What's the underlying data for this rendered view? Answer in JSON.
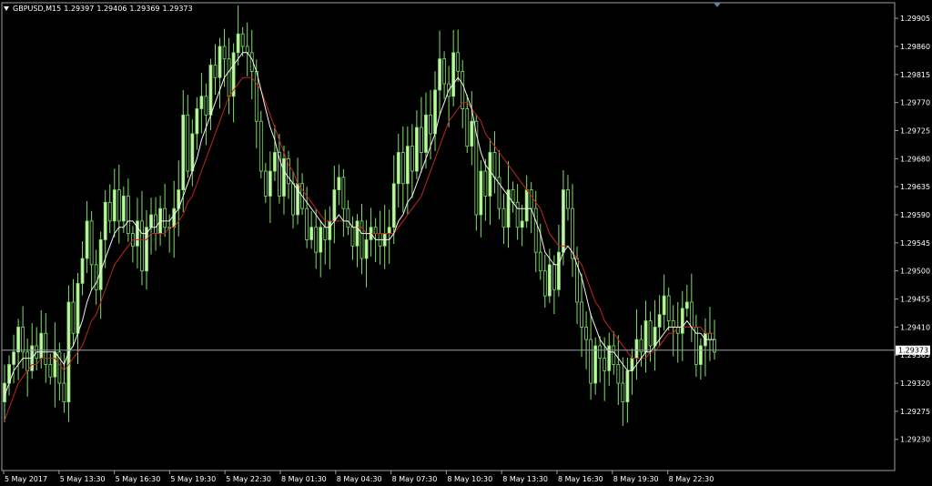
{
  "header": {
    "symbol": "GBPUSD,M15",
    "open": "1.29397",
    "high": "1.29406",
    "low": "1.29369",
    "close": "1.29373"
  },
  "colors": {
    "background": "#000000",
    "bull_candle": "#c6f3a6",
    "bull_wick": "#7fe06a",
    "bear_candle": "#000000",
    "ma_fast": "#f2f2f2",
    "ma_slow": "#c0271c",
    "axis": "#9aa0a6",
    "text": "#ffffff",
    "price_line": "#9aa0a6",
    "price_label_bg": "#ffffff"
  },
  "chart_data": {
    "type": "candlestick",
    "timeframe": "M15",
    "ylim": [
      1.2918,
      1.2993
    ],
    "yticks": [
      "1.29905",
      "1.29860",
      "1.29815",
      "1.29770",
      "1.29725",
      "1.29680",
      "1.29635",
      "1.29590",
      "1.29545",
      "1.29500",
      "1.29455",
      "1.29410",
      "1.29365",
      "1.29320",
      "1.29275",
      "1.29230"
    ],
    "xticks": [
      "5 May 2017",
      "5 May 13:30",
      "5 May 16:30",
      "5 May 19:30",
      "5 May 22:30",
      "8 May 01:30",
      "8 May 04:30",
      "8 May 07:30",
      "8 May 10:30",
      "8 May 13:30",
      "8 May 16:30",
      "8 May 19:30",
      "8 May 22:30"
    ],
    "current_price": "1.29373",
    "series": [
      {
        "kind": "close",
        "values": [
          1.2932,
          1.2935,
          1.2937,
          1.2941,
          1.2937,
          1.2934,
          1.2938,
          1.2936,
          1.294,
          1.2935,
          1.2933,
          1.2937,
          1.2932,
          1.2929,
          1.2945,
          1.294,
          1.2948,
          1.2952,
          1.2958,
          1.2951,
          1.2947,
          1.2955,
          1.2961,
          1.2958,
          1.2963,
          1.2958,
          1.2962,
          1.2956,
          1.2954,
          1.2958,
          1.295,
          1.2957,
          1.2959,
          1.2956,
          1.296,
          1.2957,
          1.2957,
          1.296,
          1.2963,
          1.2975,
          1.2966,
          1.2972,
          1.2976,
          1.2978,
          1.2975,
          1.2983,
          1.2981,
          1.2986,
          1.2984,
          1.2978,
          1.2985,
          1.2988,
          1.2986,
          1.2985,
          1.2982,
          1.2974,
          1.2966,
          1.2962,
          1.2966,
          1.2969,
          1.2962,
          1.2968,
          1.2964,
          1.2959,
          1.2964,
          1.296,
          1.2955,
          1.2957,
          1.2953,
          1.2957,
          1.2955,
          1.2958,
          1.2963,
          1.2965,
          1.296,
          1.2957,
          1.2954,
          1.2958,
          1.2952,
          1.2955,
          1.2957,
          1.2956,
          1.2954,
          1.2956,
          1.2957,
          1.2964,
          1.2969,
          1.2964,
          1.297,
          1.2966,
          1.2973,
          1.2969,
          1.2975,
          1.2972,
          1.2979,
          1.2984,
          1.298,
          1.2978,
          1.2985,
          1.2982,
          1.2976,
          1.297,
          1.2974,
          1.2959,
          1.2966,
          1.2962,
          1.2969,
          1.2965,
          1.296,
          1.2957,
          1.2963,
          1.2961,
          1.2957,
          1.2958,
          1.2963,
          1.296,
          1.2953,
          1.295,
          1.2946,
          1.2951,
          1.2947,
          1.2953,
          1.2963,
          1.296,
          1.2952,
          1.2945,
          1.2941,
          1.2939,
          1.2932,
          1.2938,
          1.2936,
          1.2934,
          1.2938,
          1.2935,
          1.2932,
          1.2929,
          1.2934,
          1.2936,
          1.2939,
          1.2937,
          1.2942,
          1.2938,
          1.2941,
          1.2943,
          1.2946,
          1.2942,
          1.2941,
          1.294,
          1.2944,
          1.2945,
          1.2941,
          1.2935,
          1.2938,
          1.294,
          1.2939,
          1.2937
        ]
      },
      {
        "kind": "ma_fast",
        "values": [
          1.293,
          1.2932,
          1.2934,
          1.2935,
          1.2936,
          1.2936,
          1.2936,
          1.2937,
          1.2937,
          1.2937,
          1.2937,
          1.2937,
          1.2936,
          1.2935,
          1.2937,
          1.2938,
          1.294,
          1.2942,
          1.2945,
          1.2947,
          1.2948,
          1.295,
          1.2952,
          1.2954,
          1.2956,
          1.2957,
          1.2957,
          1.2958,
          1.2958,
          1.2957,
          1.2956,
          1.2956,
          1.2957,
          1.2957,
          1.2958,
          1.2958,
          1.2958,
          1.2959,
          1.296,
          1.2962,
          1.2964,
          1.2966,
          1.2968,
          1.2971,
          1.2973,
          1.2975,
          1.2977,
          1.2979,
          1.2981,
          1.2982,
          1.2983,
          1.2984,
          1.2985,
          1.2985,
          1.2984,
          1.2982,
          1.2979,
          1.2976,
          1.2973,
          1.2971,
          1.2968,
          1.2966,
          1.2965,
          1.2964,
          1.2963,
          1.2962,
          1.2961,
          1.296,
          1.2959,
          1.2958,
          1.2957,
          1.2957,
          1.2958,
          1.2959,
          1.2958,
          1.2958,
          1.2957,
          1.2957,
          1.2956,
          1.2956,
          1.2956,
          1.2955,
          1.2955,
          1.2955,
          1.2955,
          1.2956,
          1.2958,
          1.2959,
          1.2961,
          1.2962,
          1.2964,
          1.2966,
          1.2968,
          1.297,
          1.2972,
          1.2975,
          1.2977,
          1.2979,
          1.298,
          1.2981,
          1.298,
          1.2978,
          1.2976,
          1.2972,
          1.2969,
          1.2967,
          1.2966,
          1.2965,
          1.2964,
          1.2963,
          1.2962,
          1.2961,
          1.296,
          1.296,
          1.296,
          1.296,
          1.2958,
          1.2956,
          1.2953,
          1.2952,
          1.2951,
          1.2951,
          1.2953,
          1.2954,
          1.2953,
          1.2951,
          1.2949,
          1.2946,
          1.2943,
          1.2941,
          1.2939,
          1.2938,
          1.2937,
          1.2937,
          1.2936,
          1.2935,
          1.2934,
          1.2934,
          1.2935,
          1.2936,
          1.2937,
          1.2937,
          1.2938,
          1.2939,
          1.294,
          1.2941,
          1.2941,
          1.2941,
          1.2941,
          1.2942,
          1.2941,
          1.294,
          1.294,
          1.2939,
          1.2939,
          1.2939
        ]
      },
      {
        "kind": "ma_slow",
        "values": [
          1.2926,
          1.2928,
          1.293,
          1.2932,
          1.2933,
          1.2934,
          1.2935,
          1.2935,
          1.2936,
          1.2936,
          1.2936,
          1.2936,
          1.2935,
          1.2934,
          1.2935,
          1.2936,
          1.2937,
          1.2938,
          1.294,
          1.2942,
          1.2943,
          1.2945,
          1.2947,
          1.2949,
          1.2951,
          1.2952,
          1.2953,
          1.2954,
          1.2955,
          1.2955,
          1.2955,
          1.2955,
          1.2956,
          1.2956,
          1.2956,
          1.2956,
          1.2957,
          1.2957,
          1.2958,
          1.2959,
          1.2961,
          1.2962,
          1.2964,
          1.2966,
          1.2968,
          1.297,
          1.2972,
          1.2974,
          1.2976,
          1.2978,
          1.2979,
          1.298,
          1.2981,
          1.2981,
          1.2981,
          1.298,
          1.2979,
          1.2977,
          1.2975,
          1.2973,
          1.2971,
          1.2969,
          1.2967,
          1.2966,
          1.2964,
          1.2963,
          1.2962,
          1.2961,
          1.296,
          1.2959,
          1.2958,
          1.2958,
          1.2958,
          1.2958,
          1.2958,
          1.2958,
          1.2957,
          1.2957,
          1.2957,
          1.2956,
          1.2956,
          1.2956,
          1.2956,
          1.2956,
          1.2956,
          1.2956,
          1.2957,
          1.2958,
          1.2959,
          1.296,
          1.2961,
          1.2962,
          1.2964,
          1.2966,
          1.2968,
          1.297,
          1.2972,
          1.2974,
          1.2975,
          1.2976,
          1.2977,
          1.2977,
          1.2976,
          1.2975,
          1.2974,
          1.2972,
          1.2971,
          1.297,
          1.2969,
          1.2968,
          1.2967,
          1.2966,
          1.2965,
          1.2964,
          1.2963,
          1.2962,
          1.2961,
          1.296,
          1.2958,
          1.2956,
          1.2955,
          1.2954,
          1.2954,
          1.2954,
          1.2953,
          1.2952,
          1.2951,
          1.2949,
          1.2947,
          1.2945,
          1.2944,
          1.2942,
          1.2941,
          1.294,
          1.2939,
          1.2938,
          1.2937,
          1.2936,
          1.2936,
          1.2936,
          1.2936,
          1.2937,
          1.2937,
          1.2938,
          1.2939,
          1.294,
          1.294,
          1.2941,
          1.2941,
          1.2941,
          1.2941,
          1.2941,
          1.2941,
          1.294,
          1.294,
          1.294
        ]
      }
    ]
  }
}
